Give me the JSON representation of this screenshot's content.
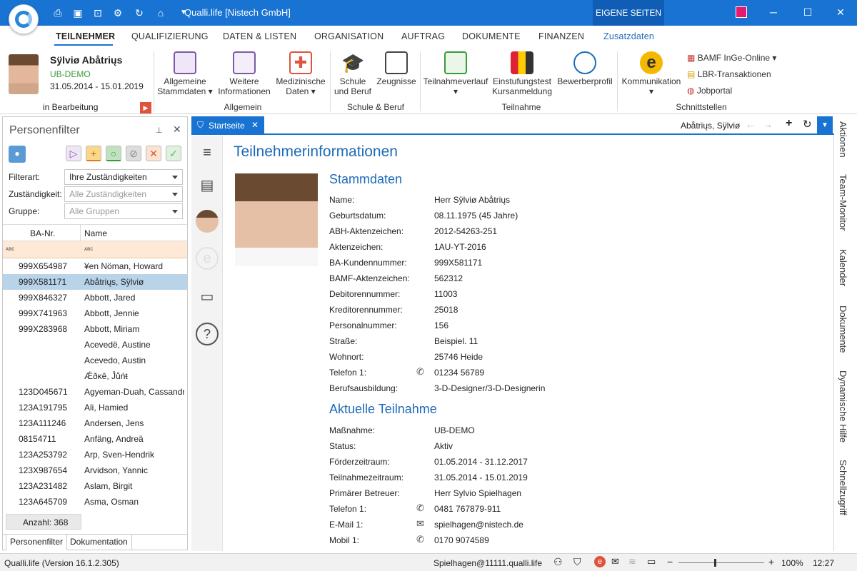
{
  "titlebar": {
    "title": "Qualli.life [Nistech GmbH]",
    "eigene_seiten": "EIGENE SEITEN",
    "minimize": "─",
    "maximize": "☐",
    "close": "✕"
  },
  "tabs": [
    "TEILNEHMER",
    "QUALIFIZIERUNG",
    "DATEN & LISTEN",
    "ORGANISATION",
    "AUFTRAG",
    "DOKUMENTE",
    "FINANZEN",
    "Zusatzdaten"
  ],
  "ribbon": {
    "user_name": "Sÿlviø Abåtriųs",
    "user_group": "UB-DEMO",
    "user_period": "31.05.2014 - 15.01.2019",
    "status": "in Bearbeitung",
    "allgemein": [
      "Allgemeine Stammdaten",
      "Weitere Informationen",
      "Medizinische Daten"
    ],
    "allgemein_label": "Allgemein",
    "schule": [
      "Schule und Beruf",
      "Zeugnisse"
    ],
    "schule_label": "Schule & Beruf",
    "teilnahme": [
      "Teilnahmeverlauf",
      "Einstufungstest Kursanmeldung",
      "Bewerberprofil"
    ],
    "teilnahme_label": "Teilnahme",
    "kommunikation": "Kommunikation",
    "schnitt_items": [
      "BAMF InGe-Online",
      "LBR-Transaktionen",
      "Jobportal"
    ],
    "schnitt_label": "Schnittstellen"
  },
  "filter": {
    "title": "Personenfilter",
    "filterart_label": "Filterart:",
    "filterart_value": "Ihre Zuständigkeiten",
    "zust_label": "Zuständigkeit:",
    "zust_placeholder": "Alle Zuständigkeiten",
    "gruppe_label": "Gruppe:",
    "gruppe_placeholder": "Alle Gruppen",
    "col_ba": "BA-Nr.",
    "col_name": "Name",
    "rows": [
      [
        "999X654987",
        "¥en Nöman, Howard"
      ],
      [
        "999X581171",
        "Abåtriųs, Sÿlviø"
      ],
      [
        "999X846327",
        "Abbott, Jared"
      ],
      [
        "999X741963",
        "Abbott, Jennie"
      ],
      [
        "999X283968",
        "Abbott, Miriam"
      ],
      [
        "",
        "Acevedë, Austine"
      ],
      [
        "",
        "Acevedo, Austin"
      ],
      [
        "",
        "Ǽðĸȇ, Ĵůńŧ"
      ],
      [
        "123D045671",
        "Agyeman-Duah, Cassandra"
      ],
      [
        "123A191795",
        "Ali, Hamied"
      ],
      [
        "123A111246",
        "Andersen, Jens"
      ],
      [
        "08154711",
        "Anfäng, Andreä"
      ],
      [
        "123A253792",
        "Arp, Sven-Hendrik"
      ],
      [
        "123X987654",
        "Arvidson, Yannic"
      ],
      [
        "123A231482",
        "Aslam, Birgit"
      ],
      [
        "123A645709",
        "Asma, Osman"
      ]
    ],
    "count": "Anzahl: 368",
    "tab1": "Personenfilter",
    "tab2": "Dokumentation"
  },
  "doc": {
    "tab": "Startseite",
    "person": "Abåtriųs, Sÿlviø",
    "title": "Teilnehmerinformationen"
  },
  "stammdaten": {
    "heading": "Stammdaten",
    "labels": [
      "Name:",
      "Geburtsdatum:",
      "ABH-Aktenzeichen:",
      "Aktenzeichen:",
      "BA-Kundennummer:",
      "BAMF-Aktenzeichen:",
      "Debitorennummer:",
      "Kreditorennummer:",
      "Personalnummer:",
      "Straße:",
      "Wohnort:",
      "Telefon 1:",
      "Berufsausbildung:"
    ],
    "values": [
      "Herr Sÿlviø Abåtriųs",
      "08.11.1975 (45 Jahre)",
      "2012-54263-251",
      "1AU-YT-2016",
      "999X581171",
      "562312",
      "11003",
      "25018",
      "156",
      "Beispiel. 11",
      "25746 Heide",
      "01234 56789",
      "3-D-Designer/3-D-Designerin"
    ]
  },
  "teilnahme": {
    "heading": "Aktuelle Teilnahme",
    "labels": [
      "Maßnahme:",
      "Status:",
      "Förderzeitraum:",
      "Teilnahmezeitraum:",
      "Primärer Betreuer:",
      "Telefon 1:",
      "E-Mail 1:",
      "Mobil 1:"
    ],
    "values": [
      "UB-DEMO",
      "Aktiv",
      "01.05.2014 - 31.12.2017",
      "31.05.2014 - 15.01.2019",
      "Herr Sylvio Spielhagen",
      "0481 767879-911",
      "spielhagen@nistech.de",
      "0170 9074589"
    ]
  },
  "rightbar": [
    "Aktionen",
    "Team-Monitor",
    "Kalender",
    "Dokumente",
    "Dynamische Hilfe",
    "Schnellzugriff"
  ],
  "status": {
    "version": "Qualli.life (Version 16.1.2.305)",
    "user": "Spielhagen@11111.qualli.life",
    "zoom": "100%",
    "time": "12:27"
  }
}
